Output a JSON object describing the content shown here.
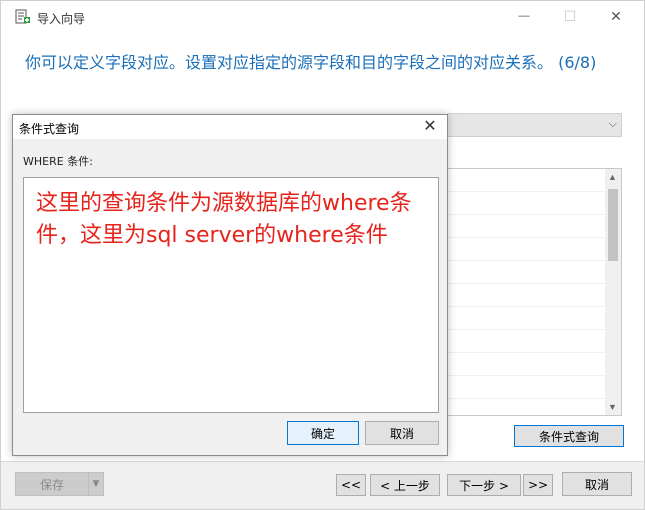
{
  "window": {
    "title": "导入向导",
    "minimize_icon": "—",
    "maximize_icon": "☐",
    "close_icon": "✕"
  },
  "heading": "你可以定义字段对应。设置对应指定的源字段和目的字段之间的对应关系。 (6/8)",
  "main": {
    "condition_query_button": "条件式查询"
  },
  "footer": {
    "save_label": "保存",
    "first_label": "<<",
    "prev_label": "< 上一步",
    "next_label": "下一步 >",
    "last_label": ">>",
    "cancel_label": "取消"
  },
  "dialog": {
    "title": "条件式查询",
    "close_icon": "✕",
    "where_label": "WHERE 条件:",
    "annotation": "这里的查询条件为源数据库的where条件，这里为sql server的where条件",
    "ok_label": "确定",
    "cancel_label": "取消"
  },
  "colors": {
    "heading": "#1a6fb8",
    "annotation": "#e8231b",
    "focus_border": "#0078d7"
  }
}
